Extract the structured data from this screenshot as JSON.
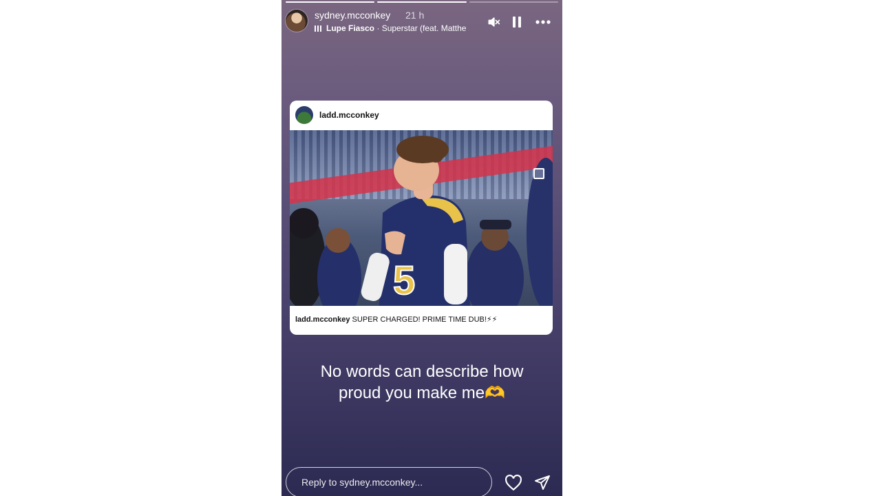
{
  "story": {
    "username": "sydney.mcconkey",
    "time_ago": "21 h",
    "music": {
      "artist": "Lupe Fiasco",
      "separator": " · ",
      "track": "Superstar (feat. Matthe"
    },
    "progress_segments": [
      1,
      1,
      0
    ]
  },
  "post_card": {
    "username": "ladd.mcconkey",
    "caption_user": "ladd.mcconkey",
    "caption_text": "SUPER CHARGED! PRIME TIME DUB!⚡⚡"
  },
  "story_text": {
    "line1": "No words can describe how",
    "line2": "proud you make me🫶"
  },
  "reply": {
    "placeholder": "Reply to sydney.mcconkey..."
  },
  "icons": {
    "mute": "muted-speaker-icon",
    "pause": "pause-icon",
    "more": "more-options-icon",
    "like": "heart-icon",
    "share": "send-icon",
    "multi": "multiple-photos-icon",
    "music": "music-bars-icon"
  }
}
